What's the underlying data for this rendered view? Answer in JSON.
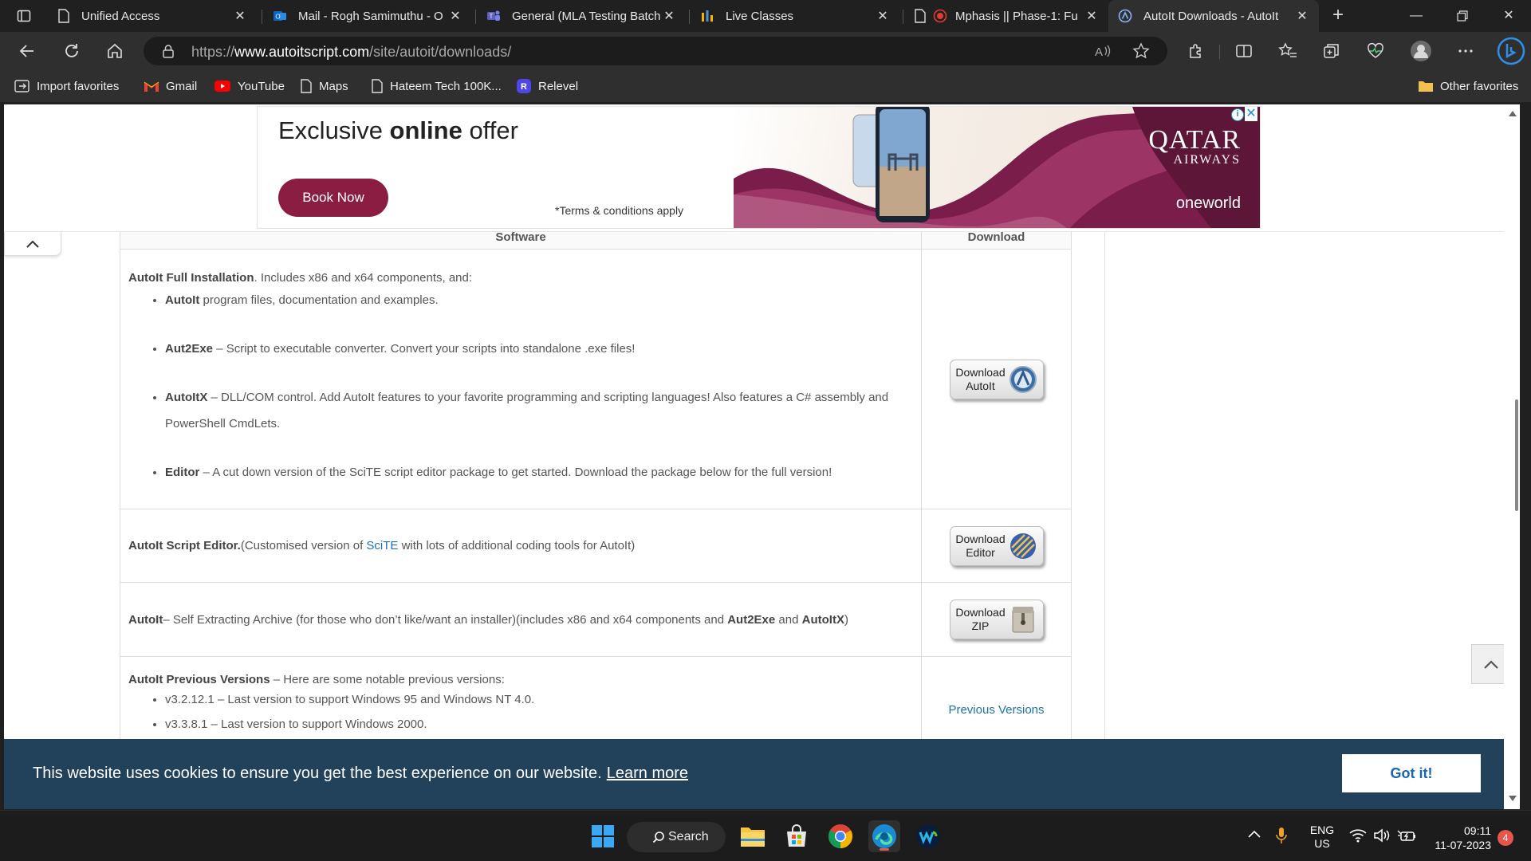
{
  "browser": {
    "tabs": [
      {
        "title": "Unified Access",
        "icon": "page-icon",
        "active": false
      },
      {
        "title": "Mail - Rogh Samimuthu - O",
        "icon": "outlook-icon",
        "active": false
      },
      {
        "title": "General (MLA Testing Batch",
        "icon": "teams-icon",
        "active": false
      },
      {
        "title": "Live Classes",
        "icon": "bars-icon",
        "active": false
      },
      {
        "title": "Mphasis || Phase-1: Fu",
        "icon": "page-icon",
        "active": false
      },
      {
        "title": "AutoIt Downloads - AutoIt",
        "icon": "autoit-icon",
        "active": true
      }
    ],
    "url_prefix": "https://",
    "url_domain": "www.autoitscript.com",
    "url_path": "/site/autoit/downloads/",
    "favorites": [
      {
        "label": "Import favorites",
        "icon": "import-icon"
      },
      {
        "label": "Gmail",
        "icon": "gmail-icon"
      },
      {
        "label": "YouTube",
        "icon": "youtube-icon"
      },
      {
        "label": "Maps",
        "icon": "page-icon"
      },
      {
        "label": "Hateem Tech 100K...",
        "icon": "page-icon"
      },
      {
        "label": "Relevel",
        "icon": "relevel-icon"
      }
    ],
    "other_favorites": "Other favorites"
  },
  "ad": {
    "headline_pre": "Exclusive ",
    "headline_bold": "online",
    "headline_post": " offer",
    "cta": "Book Now",
    "terms": "*Terms & conditions apply",
    "brand_line1": "QATAR",
    "brand_line2": "AIRWAYS",
    "alliance": "oneworld",
    "accent_color": "#8c1d42"
  },
  "table": {
    "headers": {
      "software": "Software",
      "download": "Download"
    },
    "full": {
      "title": "AutoIt Full Installation",
      "intro": ". Includes x86 and x64 components, and:",
      "items": [
        {
          "name": "AutoIt",
          "desc": " program files, documentation and examples."
        },
        {
          "name": "Aut2Exe",
          "desc": " – Script to executable converter.  Convert your scripts into standalone .exe files!"
        },
        {
          "name": "AutoItX",
          "desc": " – DLL/COM control.  Add AutoIt features to your favorite programming and scripting languages! Also features a C# assembly and PowerShell CmdLets."
        },
        {
          "name": "Editor",
          "desc": " – A cut down version of the SciTE script editor package to get started. Download the package below for the full version!"
        }
      ],
      "button_line1": "Download",
      "button_line2": "AutoIt"
    },
    "editor": {
      "title": "AutoIt Script Editor.",
      "pre": "(Customised version of ",
      "link": "SciTE",
      "post": " with lots of additional coding tools for AutoIt)",
      "button_line1": "Download",
      "button_line2": "Editor"
    },
    "archive": {
      "title": "AutoIt",
      "desc": "– Self Extracting Archive (for those who don’t like/want an installer)(includes x86 and x64 components and ",
      "bold1": "Aut2Exe",
      "and": " and ",
      "bold2": "AutoItX",
      "close": ")",
      "button_line1": "Download",
      "button_line2": "ZIP"
    },
    "previous": {
      "title": "AutoIt Previous Versions",
      "intro": " – Here are some notable previous versions:",
      "items": [
        "v3.2.12.1 – Last version to support Windows 95 and Windows NT 4.0.",
        "v3.3.8.1 – Last version to support Windows 2000."
      ],
      "link": "Previous Versions"
    }
  },
  "cookie": {
    "message": "This website uses cookies to ensure you get the best experience on our website.",
    "learn_more": "Learn more",
    "accept": "Got it!"
  },
  "taskbar": {
    "search_label": "Search",
    "lang_line1": "ENG",
    "lang_line2": "US",
    "time": "09:11",
    "date": "11-07-2023",
    "notifications": "4"
  }
}
